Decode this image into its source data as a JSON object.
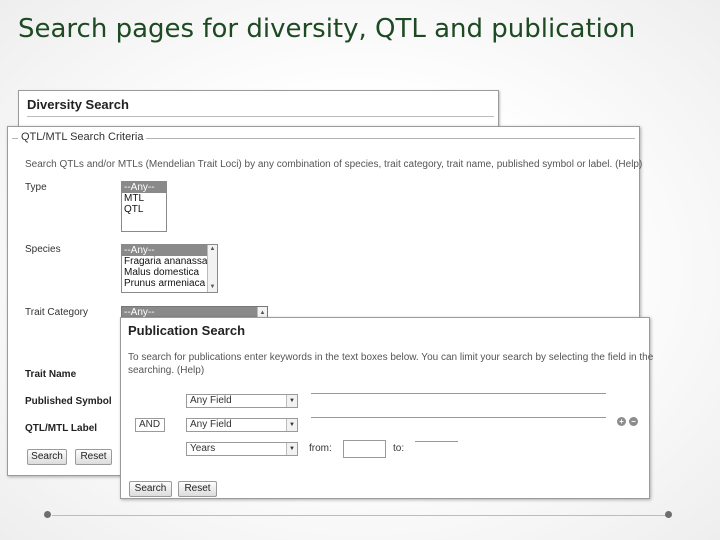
{
  "slide": {
    "title": "Search pages for diversity, QTL and publication"
  },
  "diversity": {
    "header": "Diversity Search"
  },
  "qtl": {
    "legend": "QTL/MTL Search Criteria",
    "description": "Search QTLs and/or MTLs (Mendelian Trait Loci) by any combination of species, trait category, trait name, published symbol or label. (Help)",
    "type": {
      "label": "Type",
      "options": [
        "--Any--",
        "MTL",
        "QTL"
      ]
    },
    "species": {
      "label": "Species",
      "options": [
        "--Any--",
        "Fragaria ananassa",
        "Malus domestica",
        "Prunus armeniaca"
      ]
    },
    "trait_category": {
      "label": "Trait Category",
      "value": "--Any--"
    },
    "trait_name_label": "Trait Name",
    "published_symbol_label": "Published Symbol",
    "label_label": "QTL/MTL Label",
    "search_button": "Search",
    "reset_button": "Reset"
  },
  "publication": {
    "header": "Publication Search",
    "description_line1": "To search for publications enter keywords in the text boxes below. You can limit your search by selecting the field in the",
    "description_line2": "searching. (Help)",
    "field1": "Any Field",
    "operator": "AND",
    "field2": "Any Field",
    "field3": "Years",
    "from_label": "from:",
    "to_label": "to:",
    "add_glyph": "+",
    "remove_glyph": "−",
    "search_button": "Search",
    "reset_button": "Reset"
  },
  "icons": {
    "dropdown": "▼",
    "scroll_up": "▲",
    "scroll_down": "▼"
  }
}
